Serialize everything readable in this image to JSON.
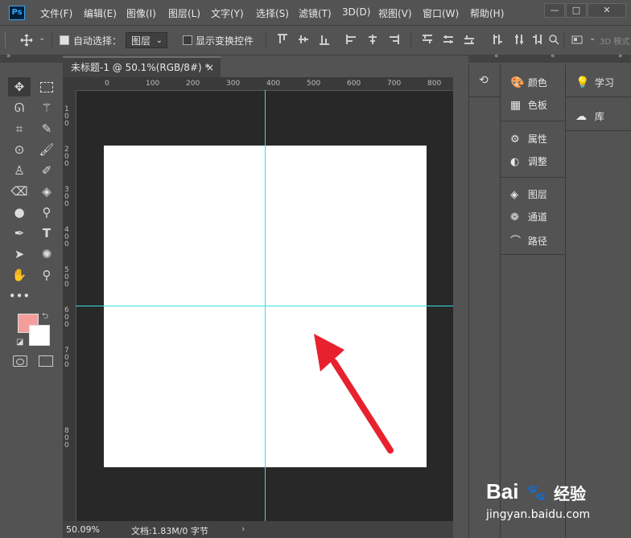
{
  "app": {
    "logo_text": "Ps"
  },
  "menu": [
    "文件(F)",
    "编辑(E)",
    "图像(I)",
    "图层(L)",
    "文字(Y)",
    "选择(S)",
    "滤镜(T)",
    "3D(D)",
    "视图(V)",
    "窗口(W)",
    "帮助(H)"
  ],
  "window_controls": [
    "—",
    "□",
    "✕"
  ],
  "options": {
    "auto_select_label": "自动选择：",
    "auto_select_checked": true,
    "layer_select_value": "图层",
    "show_transform_label": "显示变换控件",
    "show_transform_checked": false,
    "mode_3d_label": "3D 模式："
  },
  "document": {
    "tab_title": "未标题-1 @ 50.1%(RGB/8#) *",
    "close_glyph": "×",
    "ruler_top": [
      "0",
      "100",
      "200",
      "300",
      "400",
      "500",
      "600",
      "700",
      "800"
    ],
    "ruler_left": [
      "100",
      "200",
      "300",
      "400",
      "500",
      "600",
      "700",
      "800"
    ],
    "zoom": "50.09%",
    "doc_info": "文档:1.83M/0 字节"
  },
  "panels_col1": [
    {
      "icon": "color-icon",
      "label": "颜色"
    },
    {
      "icon": "swatches-icon",
      "label": "色板"
    },
    {
      "icon": "properties-icon",
      "label": "属性"
    },
    {
      "icon": "adjustments-icon",
      "label": "调整"
    },
    {
      "icon": "layers-icon",
      "label": "图层"
    },
    {
      "icon": "channels-icon",
      "label": "通道"
    },
    {
      "icon": "paths-icon",
      "label": "路径"
    }
  ],
  "panels_col2": [
    {
      "icon": "learn-icon",
      "label": "学习"
    },
    {
      "icon": "libraries-icon",
      "label": "库"
    }
  ],
  "colors": {
    "foreground": "#f59d9d",
    "background": "#ffffff",
    "guide": "#38e0e0",
    "arrow": "#e8212e"
  },
  "watermark": {
    "brand": "Bai",
    "brand2": "经验",
    "url": "jingyan.baidu.com"
  }
}
